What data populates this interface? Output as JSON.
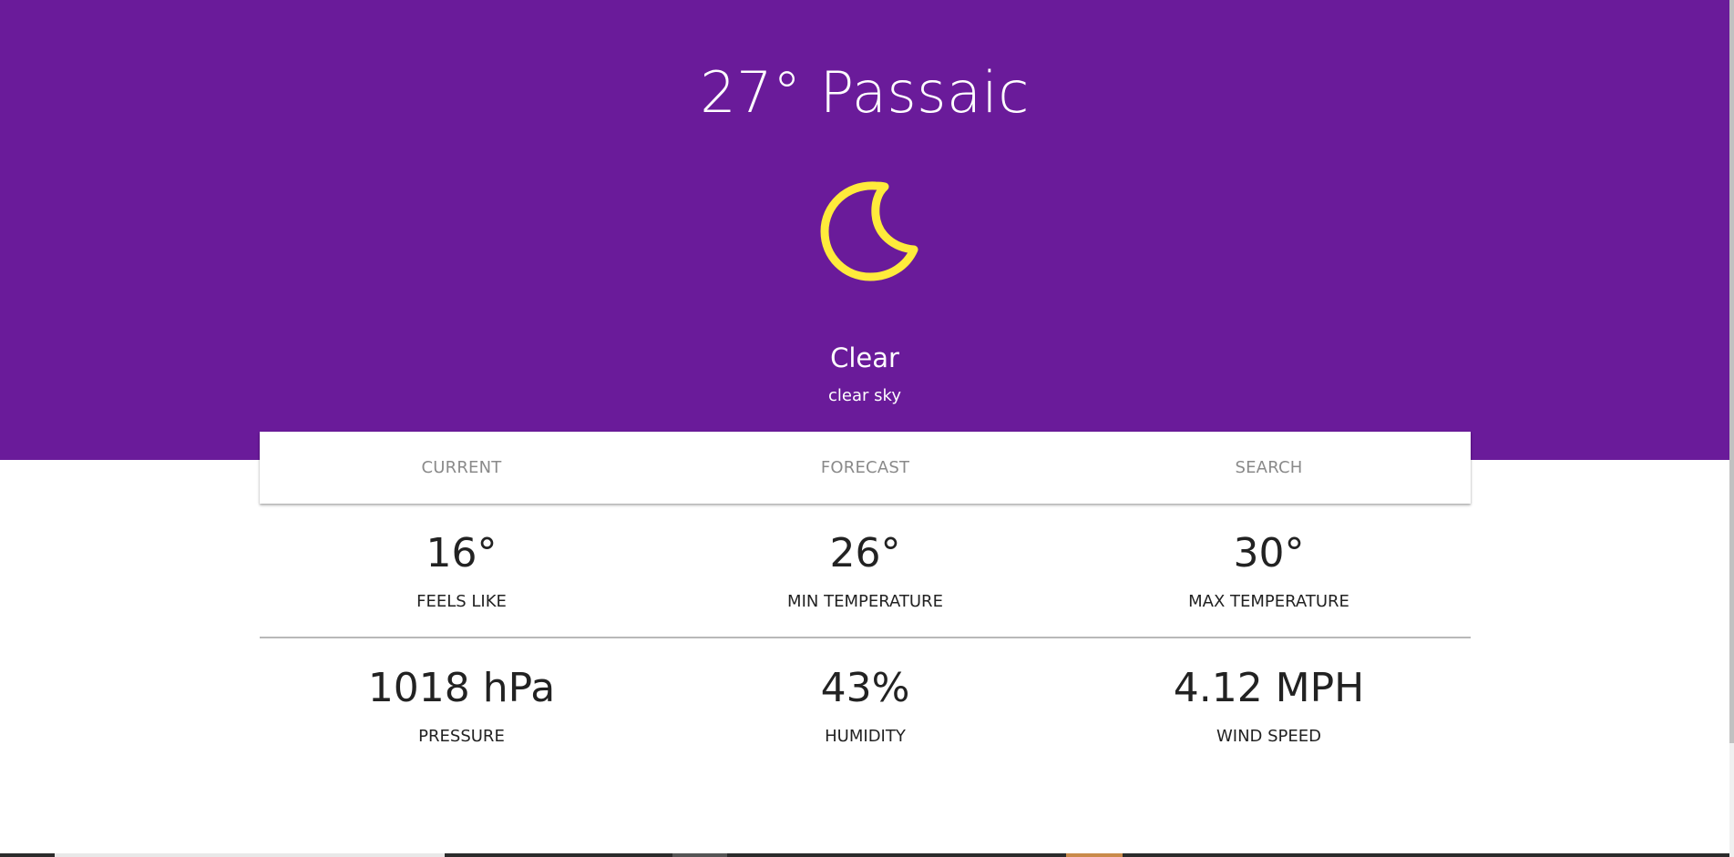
{
  "hero": {
    "title": "27° Passaic",
    "condition": "Clear",
    "description": "clear sky",
    "icon": "moon-icon",
    "background_color": "#6a1b9a",
    "icon_color": "#ffeb3b"
  },
  "tabs": [
    {
      "label": "CURRENT"
    },
    {
      "label": "FORECAST"
    },
    {
      "label": "SEARCH"
    }
  ],
  "stats": {
    "row1": [
      {
        "value": "16°",
        "label": "FEELS LIKE"
      },
      {
        "value": "26°",
        "label": "MIN TEMPERATURE"
      },
      {
        "value": "30°",
        "label": "MAX TEMPERATURE"
      }
    ],
    "row2": [
      {
        "value": "1018 hPa",
        "label": "PRESSURE"
      },
      {
        "value": "43%",
        "label": "HUMIDITY"
      },
      {
        "value": "4.12 MPH",
        "label": "WIND SPEED"
      }
    ]
  }
}
